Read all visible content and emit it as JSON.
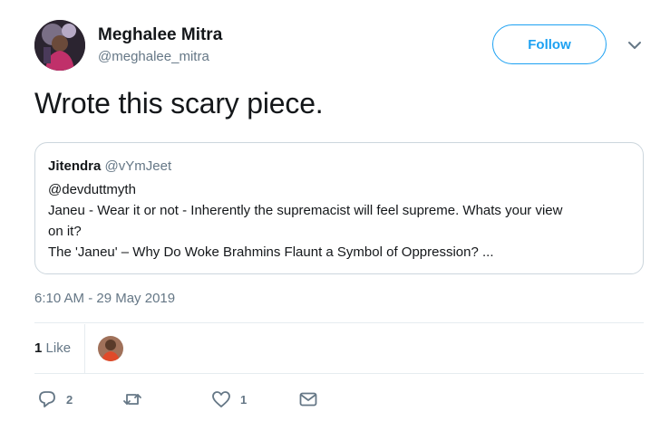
{
  "author": {
    "name": "Meghalee Mitra",
    "handle": "@meghalee_mitra"
  },
  "follow_label": "Follow",
  "tweet_text": "Wrote this scary piece.",
  "quoted_tweet": {
    "name": "Jitendra",
    "handle": "@vYmJeet",
    "mention": "@devduttmyth",
    "line1": "Janeu - Wear it or not - Inherently the supremacist will feel supreme. Whats your view",
    "line2": "on it?",
    "line3": "The 'Janeu' – Why Do Woke Brahmins Flaunt a Symbol of Oppression? ..."
  },
  "timestamp": "6:10 AM - 29 May 2019",
  "likes": {
    "count": "1",
    "label": "Like"
  },
  "actions": {
    "reply_count": "2",
    "like_count": "1"
  },
  "colors": {
    "accent": "#1da1f2",
    "secondary_text": "#657786",
    "border": "#ccd6dd",
    "divider": "#e6ecf0"
  },
  "icons": {
    "reply": "reply-icon",
    "retweet": "retweet-icon",
    "like": "heart-icon",
    "message": "envelope-icon",
    "menu": "chevron-down-icon"
  }
}
